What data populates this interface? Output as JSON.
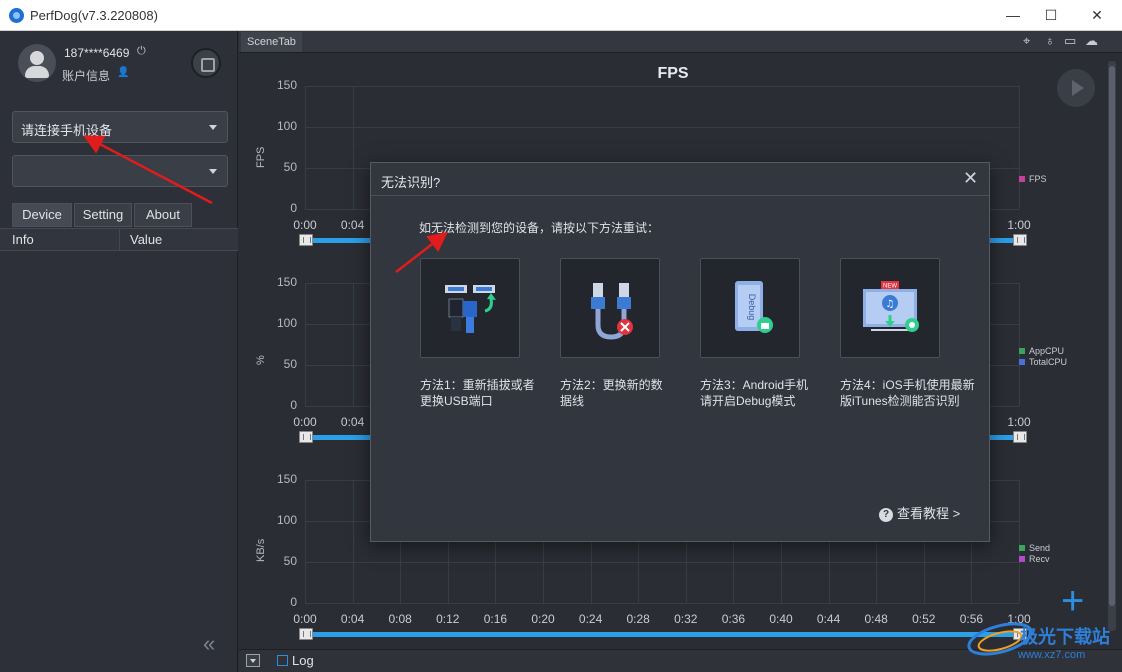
{
  "window": {
    "title": "PerfDog(v7.3.220808)",
    "minimize": "—",
    "maximize": "☐",
    "close": "✕"
  },
  "account": {
    "username": "187****6469",
    "account_label": "账户信息"
  },
  "device_select": {
    "value": "请连接手机设备"
  },
  "app_select": {
    "value": ""
  },
  "tabs": [
    "Device",
    "Setting",
    "About"
  ],
  "info_table": {
    "headers": [
      "Info",
      "Value"
    ]
  },
  "scene_tab": "SceneTab",
  "chart_data": [
    {
      "type": "line",
      "title": "FPS",
      "ylabel": "FPS",
      "ylim": [
        0,
        150
      ],
      "yticks": [
        0,
        50,
        100,
        150
      ],
      "x": [
        "0:00",
        "0:04",
        "1:00"
      ],
      "series": [
        {
          "name": "FPS",
          "values": []
        }
      ]
    },
    {
      "type": "line",
      "title": "",
      "ylabel": "%",
      "ylim": [
        0,
        150
      ],
      "yticks": [
        0,
        50,
        100,
        150
      ],
      "x": [
        "0:00",
        "0:04",
        "1:00"
      ],
      "series": [
        {
          "name": "AppCPU",
          "values": []
        },
        {
          "name": "TotalCPU",
          "values": []
        }
      ]
    },
    {
      "type": "line",
      "title": "",
      "ylabel": "KB/s",
      "ylim": [
        0,
        150
      ],
      "yticks": [
        0,
        50,
        100,
        150
      ],
      "x": [
        "0:00",
        "0:04",
        "0:08",
        "0:12",
        "0:16",
        "0:20",
        "0:24",
        "0:28",
        "0:32",
        "0:36",
        "0:40",
        "0:44",
        "0:48",
        "0:52",
        "0:56",
        "1:00"
      ],
      "series": [
        {
          "name": "Send",
          "values": []
        },
        {
          "name": "Recv",
          "values": []
        }
      ]
    }
  ],
  "legend_colors": {
    "FPS": "#c4409a",
    "AppCPU": "#3aa55a",
    "TotalCPU": "#4a6fd8",
    "Send": "#3aa55a",
    "Recv": "#b04cc8"
  },
  "bottom": {
    "log_label": "Log"
  },
  "dialog": {
    "title": "无法识别?",
    "message": "如无法检测到您的设备，请按以下方法重试：",
    "methods": [
      {
        "line1": "方法1：重新插拔或者",
        "line2": "更换USB端口",
        "icon": "usb-port-icon"
      },
      {
        "line1": "方法2：更换新的数",
        "line2": "据线",
        "icon": "usb-cable-icon"
      },
      {
        "line1": "方法3：Android手机",
        "line2": "请开启Debug模式",
        "icon": "android-debug-icon"
      },
      {
        "line1": "方法4：iOS手机使用最新",
        "line2": "版iTunes检测能否识别",
        "icon": "itunes-icon"
      }
    ],
    "tutorial_label": "查看教程 >",
    "debug_badge": "Debug",
    "new_badge": "NEW"
  },
  "watermark": {
    "text": "极光下载站",
    "url": "www.xz7.com"
  }
}
